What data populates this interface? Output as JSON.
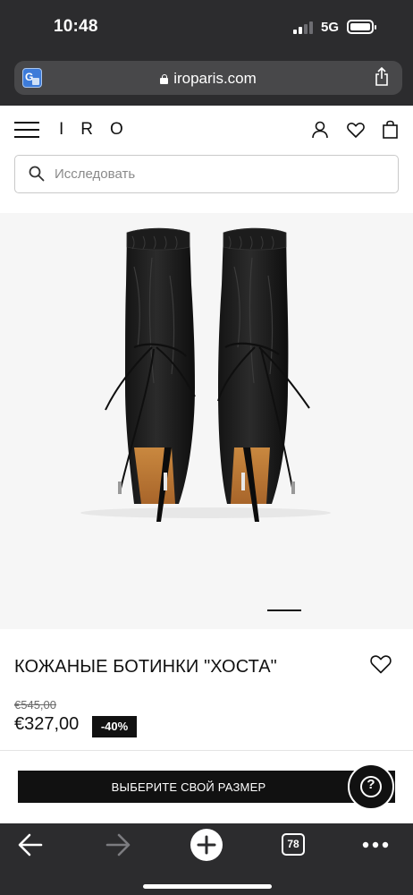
{
  "status_bar": {
    "time": "10:48",
    "network": "5G"
  },
  "browser": {
    "url": "iroparis.com",
    "icons": [
      "translate-icon",
      "lock-icon",
      "share-icon"
    ]
  },
  "header": {
    "brand": "IRO",
    "icons": [
      "menu-icon",
      "account-icon",
      "heart-icon",
      "bag-icon"
    ],
    "search": {
      "placeholder": "Исследовать",
      "value": ""
    }
  },
  "product": {
    "title": "КОЖАНЫЕ БОТИНКИ \"ХОСТА\"",
    "old_price": "€545,00",
    "new_price": "€327,00",
    "discount": "-40%"
  },
  "actions": {
    "select_size": "ВЫБЕРИТЕ СВОЙ РАЗМЕР",
    "help": "?"
  },
  "toolbar": {
    "tabs_count": "78",
    "icons": [
      "back-icon",
      "forward-icon",
      "new-tab-icon",
      "tabs-icon",
      "more-icon"
    ]
  },
  "colors": {
    "chrome": "#2c2c2e",
    "url_field": "#48484a",
    "accent_black": "#111111",
    "image_bg": "#f6f6f6"
  }
}
